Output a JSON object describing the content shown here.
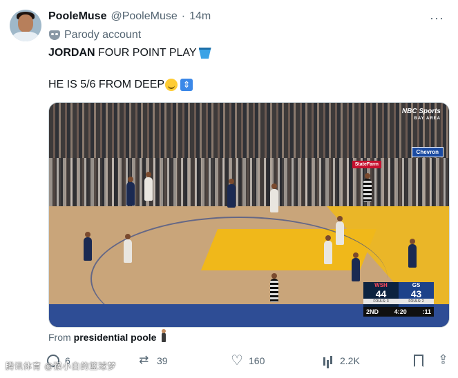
{
  "tweet": {
    "display_name": "PooleMuse",
    "handle": "@PooleMuse",
    "separator": "·",
    "time": "14m",
    "parody_label": "Parody account",
    "line1_bold": "JORDAN",
    "line1_rest": " FOUR POINT PLAY",
    "line2": "HE IS 5/6 FROM DEEP",
    "from_label": "From",
    "from_source": "presidential poole"
  },
  "icons": {
    "more": "more-icon",
    "parody": "mask-icon",
    "line1_emoji": "bucket-icon",
    "line2_emoji_1": "smile-icon",
    "line2_emoji_2": "up-down-arrow-icon",
    "from_emoji": "person-icon"
  },
  "media": {
    "broadcast_logo": "NBC Sports",
    "broadcast_sub": "BAY AREA",
    "sign_chevron": "Chevron",
    "sign_statefarm": "StateFarm",
    "scoreboard": {
      "home_abbr": "WSH",
      "home_score": "44",
      "home_fouls": "FOULS: 3",
      "away_abbr": "GS",
      "away_score": "43",
      "away_fouls": "FOULS: 2",
      "quarter": "2ND",
      "clock": "4:20",
      "shot_clock": ":11"
    }
  },
  "actions": {
    "replies": "6",
    "retweets": "39",
    "likes": "160",
    "views": "2.2K"
  },
  "watermark": "腾讯体育 @猴小白的篮球梦",
  "colors": {
    "text_primary": "#0f1419",
    "text_secondary": "#536471",
    "court_yellow": "#f0b81a",
    "court_blue": "#2e4d95"
  }
}
